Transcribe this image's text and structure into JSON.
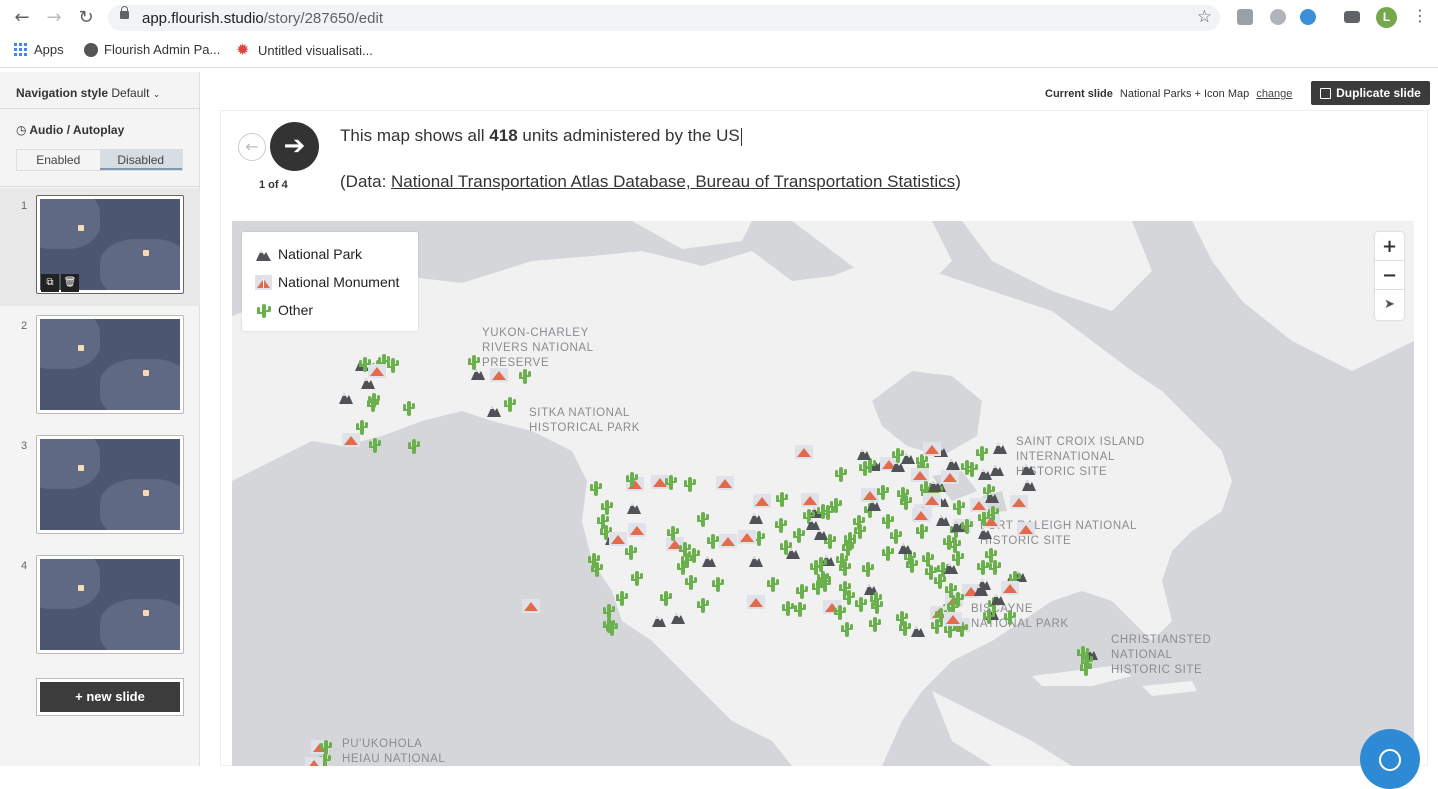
{
  "browser": {
    "url_host": "app.flourish.studio",
    "url_path": "/story/287650/edit",
    "avatar_letter": "L",
    "bookmarks": [
      {
        "label": "Apps"
      },
      {
        "label": "Flourish Admin Pa..."
      },
      {
        "label": "Untitled visualisati..."
      }
    ]
  },
  "sidebar": {
    "navigation_style_label": "Navigation style",
    "navigation_style_value": "Default",
    "audio_title": "Audio / Autoplay",
    "audio_options": [
      "Enabled",
      "Disabled"
    ],
    "audio_selected": "Disabled",
    "slides": [
      {
        "number": "1"
      },
      {
        "number": "2"
      },
      {
        "number": "3"
      },
      {
        "number": "4"
      }
    ],
    "new_slide_label": "+ new slide"
  },
  "toolbar": {
    "current_slide_label": "Current slide",
    "current_slide_value": "National Parks + Icon Map",
    "change_label": "change",
    "duplicate_label": "Duplicate slide"
  },
  "story": {
    "counter": "1 of 4",
    "text_before": "This map shows all ",
    "text_bold": "418",
    "text_after": " units administered by the US",
    "source_prefix": "(Data: ",
    "source_link": "National Transportation Atlas Database, Bureau of Transportation Statistics",
    "source_suffix": ")"
  },
  "map": {
    "legend": [
      {
        "label": "National Park",
        "icon": "mountain-icon",
        "color": "#555a60"
      },
      {
        "label": "National Monument",
        "icon": "monument-icon",
        "color": "#e07050"
      },
      {
        "label": "Other",
        "icon": "cactus-icon",
        "color": "#6ab04c"
      }
    ],
    "labels": [
      {
        "text": "YUKON-CHARLEY\nRIVERS NATIONAL\nPRESERVE"
      },
      {
        "text": "SITKA NATIONAL\nHISTORICAL PARK"
      },
      {
        "text": "SAINT CROIX ISLAND\nINTERNATIONAL\nHISTORIC SITE"
      },
      {
        "text": "FORT RALEIGH NATIONAL\nHISTORIC SITE"
      },
      {
        "text": "BISCAYNE\nNATIONAL PARK"
      },
      {
        "text": "CHRISTIANSTED\nNATIONAL\nHISTORIC SITE"
      },
      {
        "text": "PU'UKOHOLA\nHEIAU NATIONAL"
      }
    ],
    "colors": {
      "water": "#d4d6d9",
      "land": "#f1f1f1",
      "park": "#4f5358",
      "monument": "#e36b4c",
      "other": "#6ab04c"
    }
  }
}
